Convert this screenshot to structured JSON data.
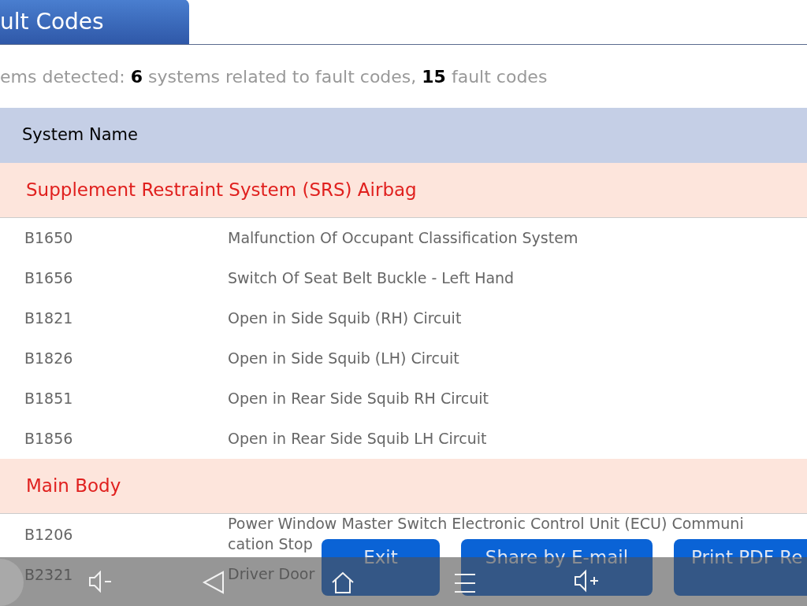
{
  "tab": {
    "label": "ult Codes",
    "selected": true
  },
  "summary": "ems detected: **6** systems related to fault codes, **15** fault codes",
  "table": {
    "columns": [
      "System Name"
    ],
    "groups": [
      {
        "name": "Supplement Restraint System (SRS) Airbag",
        "rows": [
          {
            "code": "B1650",
            "description": "Malfunction Of Occupant Classification System"
          },
          {
            "code": "B1656",
            "description": "Switch Of Seat Belt Buckle - Left Hand"
          },
          {
            "code": "B1821",
            "description": "Open in Side Squib (RH) Circuit"
          },
          {
            "code": "B1826",
            "description": "Open in Side Squib (LH) Circuit"
          },
          {
            "code": "B1851",
            "description": "Open in Rear Side Squib RH Circuit"
          },
          {
            "code": "B1856",
            "description": "Open in Rear Side Squib LH Circuit"
          }
        ]
      },
      {
        "name": "Main Body",
        "rows": [
          {
            "code": "B1206",
            "description": "Power Window Master Switch Electronic Control Unit (ECU) Communi cation Stop"
          },
          {
            "code": "B2321",
            "description": "Driver Door"
          }
        ]
      }
    ]
  },
  "buttons": [
    "Exit",
    "Share by E-mail",
    "Print PDF Re"
  ]
}
